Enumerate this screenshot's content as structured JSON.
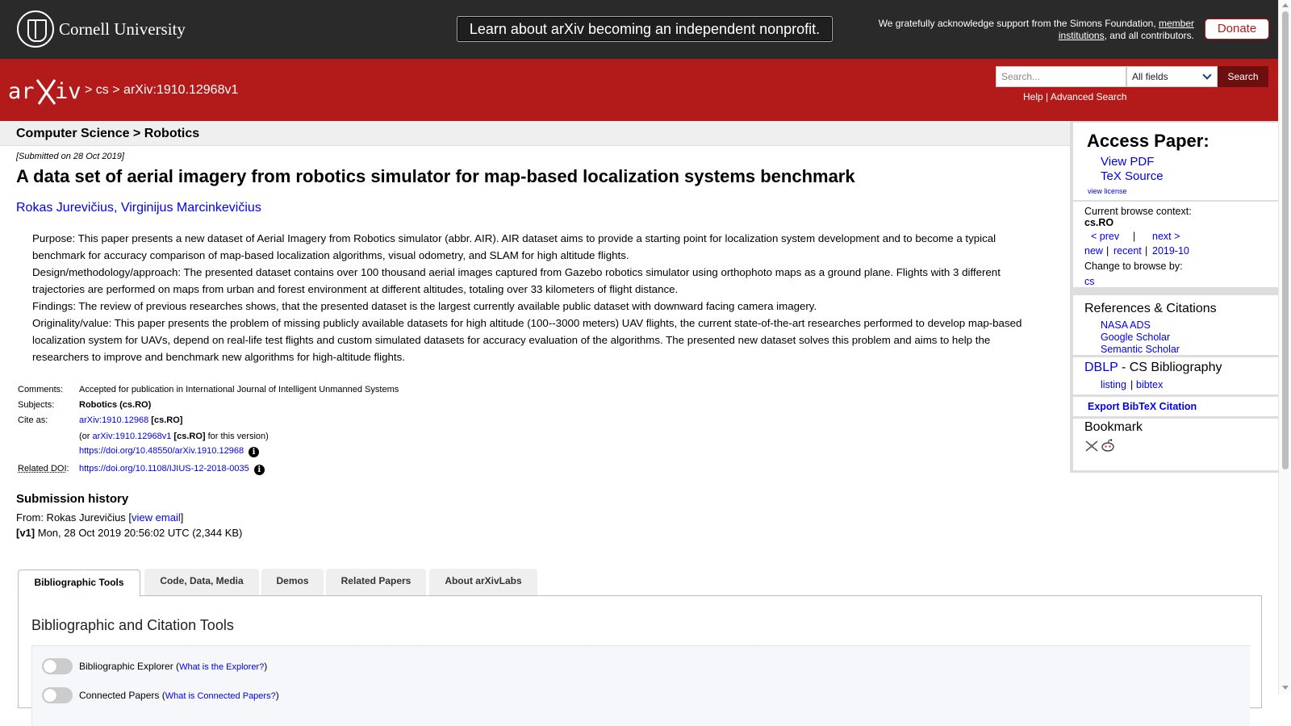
{
  "topbar": {
    "institution": "Cornell University",
    "notice": "Learn about arXiv becoming an independent nonprofit.",
    "ack_prefix": "We gratefully acknowledge support from the Simons Foundation, ",
    "ack_link": "member institutions",
    "ack_suffix": ", and all contributors.",
    "donate": "Donate"
  },
  "header": {
    "breadcrumb_sep1": ">",
    "breadcrumb_cs": "cs",
    "breadcrumb_sep2": ">",
    "breadcrumb_id": "arXiv:1910.12968v1",
    "search_placeholder": "Search...",
    "field_select": "All fields",
    "search_button": "Search",
    "help": "Help",
    "advanced": "Advanced Search"
  },
  "subheader": "Computer Science > Robotics",
  "paper": {
    "submitted": "[Submitted on 28 Oct 2019]",
    "title": "A data set of aerial imagery from robotics simulator for map-based localization systems benchmark",
    "author1": "Rokas Jurevičius",
    "author_sep": ", ",
    "author2": "Virginijus Marcinkevičius",
    "abstract": [
      "Purpose: This paper presents a new dataset of Aerial Imagery from Robotics simulator (abbr. AIR). AIR dataset aims to provide a starting point for localization system development and to become a typical benchmark for accuracy comparison of map-based localization algorithms, visual odometry, and SLAM for high altitude flights.",
      "Design/methodology/approach: The presented dataset contains over 100 thousand aerial images captured from Gazebo robotics simulator using orthophoto maps as a ground plane. Flights with 3 different trajectories are performed on maps from urban and forest environment at different altitudes, totaling over 33 kilometers of flight distance.",
      "Findings: The review of previous researches shows, that the presented dataset is the largest currently available public dataset with downward facing camera imagery.",
      "Originality/value: This paper presents the problem of missing publicly available datasets for high altitude (100--3000 meters) UAV flights, the current state-of-the-art researches performed to develop map-based localization system for UAVs, depend on real-life test flights and custom simulated datasets for accuracy evaluation of the algorithms. The presented new dataset solves this problem and aims to help the researchers to improve and benchmark new algorithms for high-altitude flights."
    ]
  },
  "meta": {
    "comments_label": "Comments:",
    "comments": "Accepted for publication in International Journal of Intelligent Unmanned Systems",
    "subjects_label": "Subjects:",
    "subjects": "Robotics (cs.RO)",
    "cite_label": "Cite as:",
    "cite_link": "arXiv:1910.12968",
    "cite_tag": " [cs.RO]",
    "or_prefix": "(or ",
    "or_link": "arXiv:1910.12968v1",
    "or_tag": " [cs.RO]",
    "or_suffix": " for this version)",
    "doi": "https://doi.org/10.48550/arXiv.1910.12968",
    "related_label": "Related DOI",
    "related_colon": ":",
    "related_doi": "https://doi.org/10.1108/IJIUS-12-2018-0035",
    "info_glyph": "i"
  },
  "history": {
    "title": "Submission history",
    "from_prefix": "From: Rokas Jurevičius [",
    "view_email": "view email",
    "from_suffix": "]",
    "v1_tag": "[v1]",
    "v1_text": " Mon, 28 Oct 2019 20:56:02 UTC (2,344 KB)"
  },
  "tabs": [
    "Bibliographic Tools",
    "Code, Data, Media",
    "Demos",
    "Related Papers",
    "About arXivLabs"
  ],
  "panel": {
    "title": "Bibliographic and Citation Tools",
    "toggle1_label": "Bibliographic Explorer (",
    "toggle1_link": "What is the Explorer?",
    "toggle1_end": ")",
    "toggle2_label": "Connected Papers (",
    "toggle2_link": "What is Connected Papers?",
    "toggle2_end": ")"
  },
  "sidebar": {
    "access_title": "Access Paper:",
    "view_pdf": "View PDF",
    "tex_source": "TeX Source",
    "view_license": "view license",
    "browse_context": "Current browse context:",
    "context": "cs.RO",
    "prev": "< prev",
    "pipe": "|",
    "next": "next >",
    "new": "new",
    "recent": "recent",
    "month": "2019-10",
    "change_browse": "Change to browse by:",
    "cs": "cs",
    "refs_title": "References & Citations",
    "nasa": "NASA ADS",
    "scholar": "Google Scholar",
    "semantic": "Semantic Scholar",
    "dblp": "DBLP",
    "dblp_suffix": " - CS Bibliography",
    "listing": "listing",
    "bibtex": "bibtex",
    "export": "Export BibTeX Citation",
    "bookmark": "Bookmark"
  },
  "colors": {
    "arxiv_red": "#b31b1b",
    "topbar": "#2a2a2a",
    "link": "#0000ee"
  }
}
